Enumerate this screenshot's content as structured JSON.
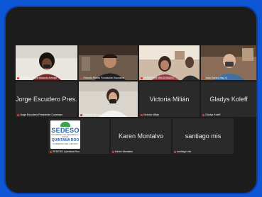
{
  "tiles": {
    "t1": {
      "label": "SEDESO_Maria Abascal Adrego"
    },
    "t2": {
      "label": "Orlando Rivero Fundación Escudero"
    },
    "t3": {
      "label": "JONATHAN MALDONADO"
    },
    "t4": {
      "label": "Juan Carlos May Q"
    },
    "t5": {
      "name": "Jorge Escudero Pres...",
      "label": "Jorge Escudero Presidente Coneeqro"
    },
    "t6": {
      "label": "Yolanda Nieves"
    },
    "t7": {
      "name": "Victoria Milián",
      "label": "Victoria Milián"
    },
    "t8": {
      "name": "Gladys Koleff",
      "label": "Gladys Koleff"
    },
    "t9": {
      "label": "SEDESO Quintana Roo",
      "logo_title": "SEDESO",
      "logo_sub": "SECRETARÍA DE DESARROLLO SOCIAL",
      "logo_state": "QUINTANA ROO",
      "logo_tag": "GOBIERNO DEL ESTADO"
    },
    "t10": {
      "name": "Karen Montalvo",
      "label": "Karen Montalvo"
    },
    "t11": {
      "name": "santiago mis",
      "label": "santiago mis"
    }
  }
}
